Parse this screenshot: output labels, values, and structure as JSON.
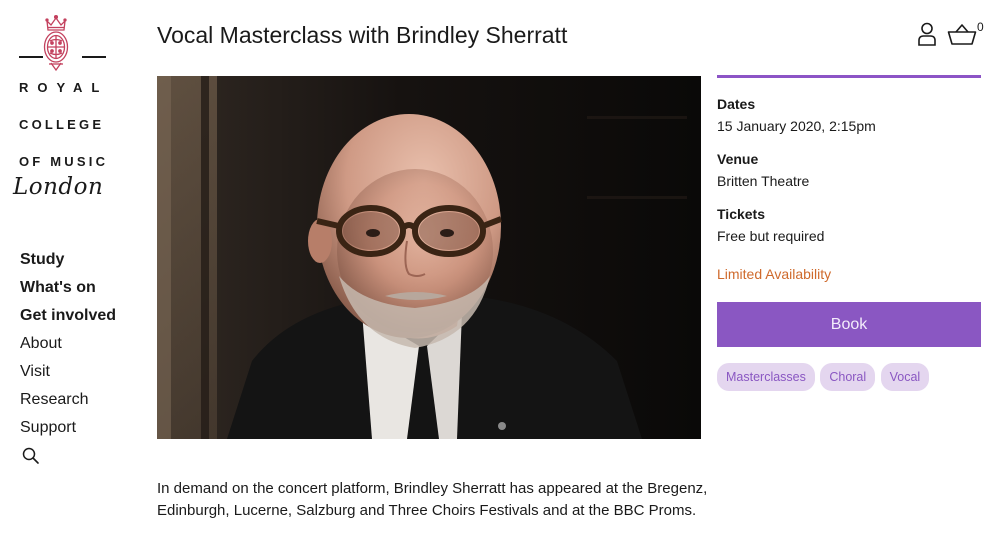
{
  "logo": {
    "royal": "ROYAL",
    "college": "COLLEGE",
    "of_music": "OF MUSIC",
    "city": "London"
  },
  "nav": {
    "items": [
      {
        "label": "Study"
      },
      {
        "label": "What's on"
      },
      {
        "label": "Get involved"
      },
      {
        "label": "About"
      },
      {
        "label": "Visit"
      },
      {
        "label": "Research"
      },
      {
        "label": "Support"
      }
    ]
  },
  "header": {
    "title": "Vocal Masterclass with Brindley Sherratt",
    "basket_count": "0"
  },
  "event": {
    "dates_label": "Dates",
    "dates_value": "15 January 2020, 2:15pm",
    "venue_label": "Venue",
    "venue_value": "Britten Theatre",
    "tickets_label": "Tickets",
    "tickets_value": "Free but required",
    "availability": "Limited Availability",
    "book_label": "Book",
    "tags": [
      "Masterclasses",
      "Choral",
      "Vocal"
    ]
  },
  "intro": "In demand on the concert platform, Brindley Sherratt has appeared at the Bregenz, Edinburgh, Lucerne, Salzburg and Three Choirs Festivals and at the BBC Proms.",
  "colors": {
    "accent": "#8a57c2",
    "tag_bg": "#e4d6ef",
    "availability": "#cf6a2c",
    "crest": "#c3415e"
  },
  "icons": {
    "account": "person-icon",
    "basket": "basket-icon",
    "search": "search-icon",
    "crest": "royal-crest-icon"
  }
}
